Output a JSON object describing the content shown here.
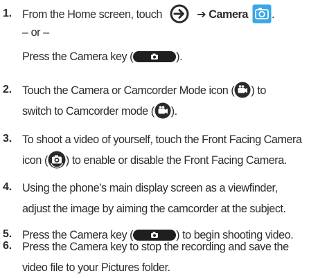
{
  "steps": [
    {
      "number": "1.",
      "lines": {
        "l1_pre": "From the Home screen, touch",
        "l1_camera": "Camera",
        "l1_post": ".",
        "l2": "– or –",
        "l3_pre": "Press the Camera key (",
        "l3_post": ")."
      }
    },
    {
      "number": "2.",
      "lines": {
        "l1_pre": "Touch the Camera or Camcorder Mode icon (",
        "l1_post": ") to",
        "l2_pre": "switch to Camcorder mode (",
        "l2_post": ")."
      }
    },
    {
      "number": "3.",
      "lines": {
        "l1": "To shoot a video of yourself, touch the Front Facing Camera",
        "l2_pre": "icon (",
        "l2_post": ") to enable or disable the Front Facing Camera."
      }
    },
    {
      "number": "4.",
      "lines": {
        "l1": "Using the phone’s main display screen as a viewfinder,",
        "l2": "adjust the image by aiming the camcorder at the subject."
      }
    },
    {
      "number": "5.",
      "lines": {
        "l1_pre": "Press the Camera key (",
        "l1_post": ") to begin shooting video."
      }
    },
    {
      "number": "6.",
      "lines": {
        "l1": "Press the Camera key to stop the recording and save the",
        "l2": "video file to your Pictures folder."
      }
    }
  ],
  "arrow": "➔",
  "icons": {
    "home_arrow": "home-arrow-icon",
    "camera_app": "camera-app-icon",
    "camera_key": "camera-key-icon",
    "mode": "camcorder-mode-icon",
    "camcorder": "camcorder-icon",
    "front_camera": "front-facing-camera-icon"
  },
  "colors": {
    "text": "#2b2b2b",
    "icon_dark": "#2a2a2a",
    "camera_app_blue": "#3aa7e6"
  }
}
